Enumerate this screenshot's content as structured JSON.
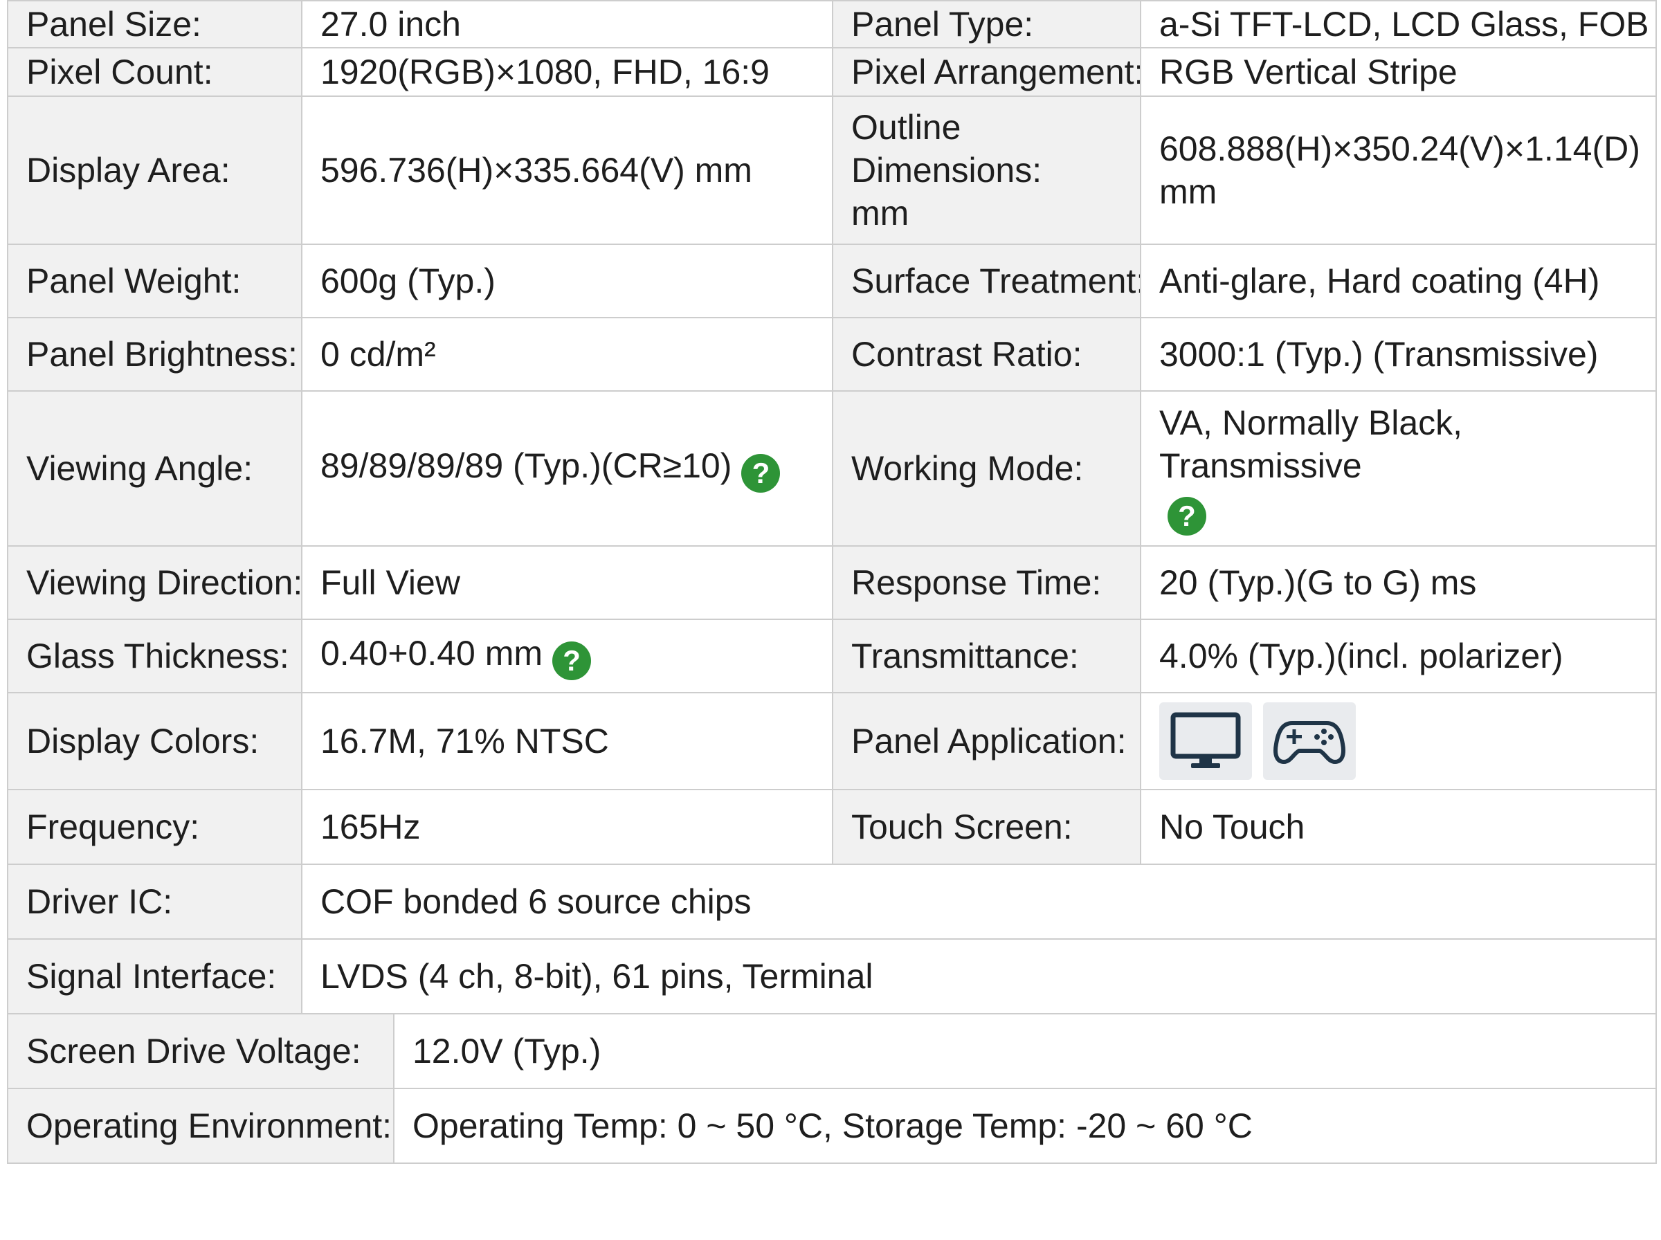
{
  "rows": {
    "panel_size_label": "Panel Size:",
    "panel_size_value": "27.0 inch",
    "panel_type_label": "Panel Type:",
    "panel_type_value": "a-Si TFT-LCD, LCD Glass, FOB",
    "pixel_count_label": "Pixel Count:",
    "pixel_count_value": "1920(RGB)×1080, FHD, 16:9",
    "pixel_arrangement_label": "Pixel Arrangement:",
    "pixel_arrangement_value": "RGB Vertical Stripe",
    "display_area_label": "Display Area:",
    "display_area_value": "596.736(H)×335.664(V) mm",
    "outline_dimensions_label": "Outline Dimensions: mm",
    "outline_dimensions_value": "608.888(H)×350.24(V)×1.14(D) mm",
    "panel_weight_label": "Panel Weight:",
    "panel_weight_value": "600g (Typ.)",
    "surface_treatment_label": "Surface Treatment:",
    "surface_treatment_value": "Anti-glare, Hard coating (4H)",
    "panel_brightness_label": "Panel Brightness:",
    "panel_brightness_value": "0 cd/m²",
    "contrast_ratio_label": "Contrast Ratio:",
    "contrast_ratio_value": "3000:1 (Typ.) (Transmissive)",
    "viewing_angle_label": "Viewing Angle:",
    "viewing_angle_value": "89/89/89/89 (Typ.)(CR≥10)",
    "working_mode_label": "Working Mode:",
    "working_mode_value": "VA, Normally Black, Transmissive",
    "viewing_direction_label": "Viewing Direction:",
    "viewing_direction_value": "Full View",
    "response_time_label": "Response Time:",
    "response_time_value": "20 (Typ.)(G to G) ms",
    "glass_thickness_label": "Glass Thickness:",
    "glass_thickness_value": "0.40+0.40 mm",
    "transmittance_label": "Transmittance:",
    "transmittance_value": "4.0% (Typ.)(incl. polarizer)",
    "display_colors_label": "Display Colors:",
    "display_colors_value": "16.7M, 71% NTSC",
    "panel_application_label": "Panel Application:",
    "frequency_label": "Frequency:",
    "frequency_value": "165Hz",
    "touch_screen_label": "Touch Screen:",
    "touch_screen_value": "No Touch",
    "driver_ic_label": "Driver IC:",
    "driver_ic_value": "COF bonded 6 source chips",
    "signal_interface_label": "Signal Interface:",
    "signal_interface_value": "LVDS (4 ch, 8-bit), 61 pins, Terminal",
    "screen_drive_voltage_label": "Screen Drive Voltage:",
    "screen_drive_voltage_value": "12.0V (Typ.)",
    "operating_environment_label": "Operating Environment:",
    "operating_environment_value": "Operating Temp: 0 ~ 50 °C, Storage Temp: -20 ~ 60 °C"
  },
  "help_glyph": "?",
  "icons": {
    "help": "question-circle-icon",
    "application_1": "monitor-icon",
    "application_2": "gamepad-icon"
  },
  "colors": {
    "help_badge": "#2e9437",
    "label_background": "#f1f1f1",
    "border": "#cdcdcd",
    "icon_tile": "#e9ebee",
    "icon_stroke": "#1f3447"
  }
}
